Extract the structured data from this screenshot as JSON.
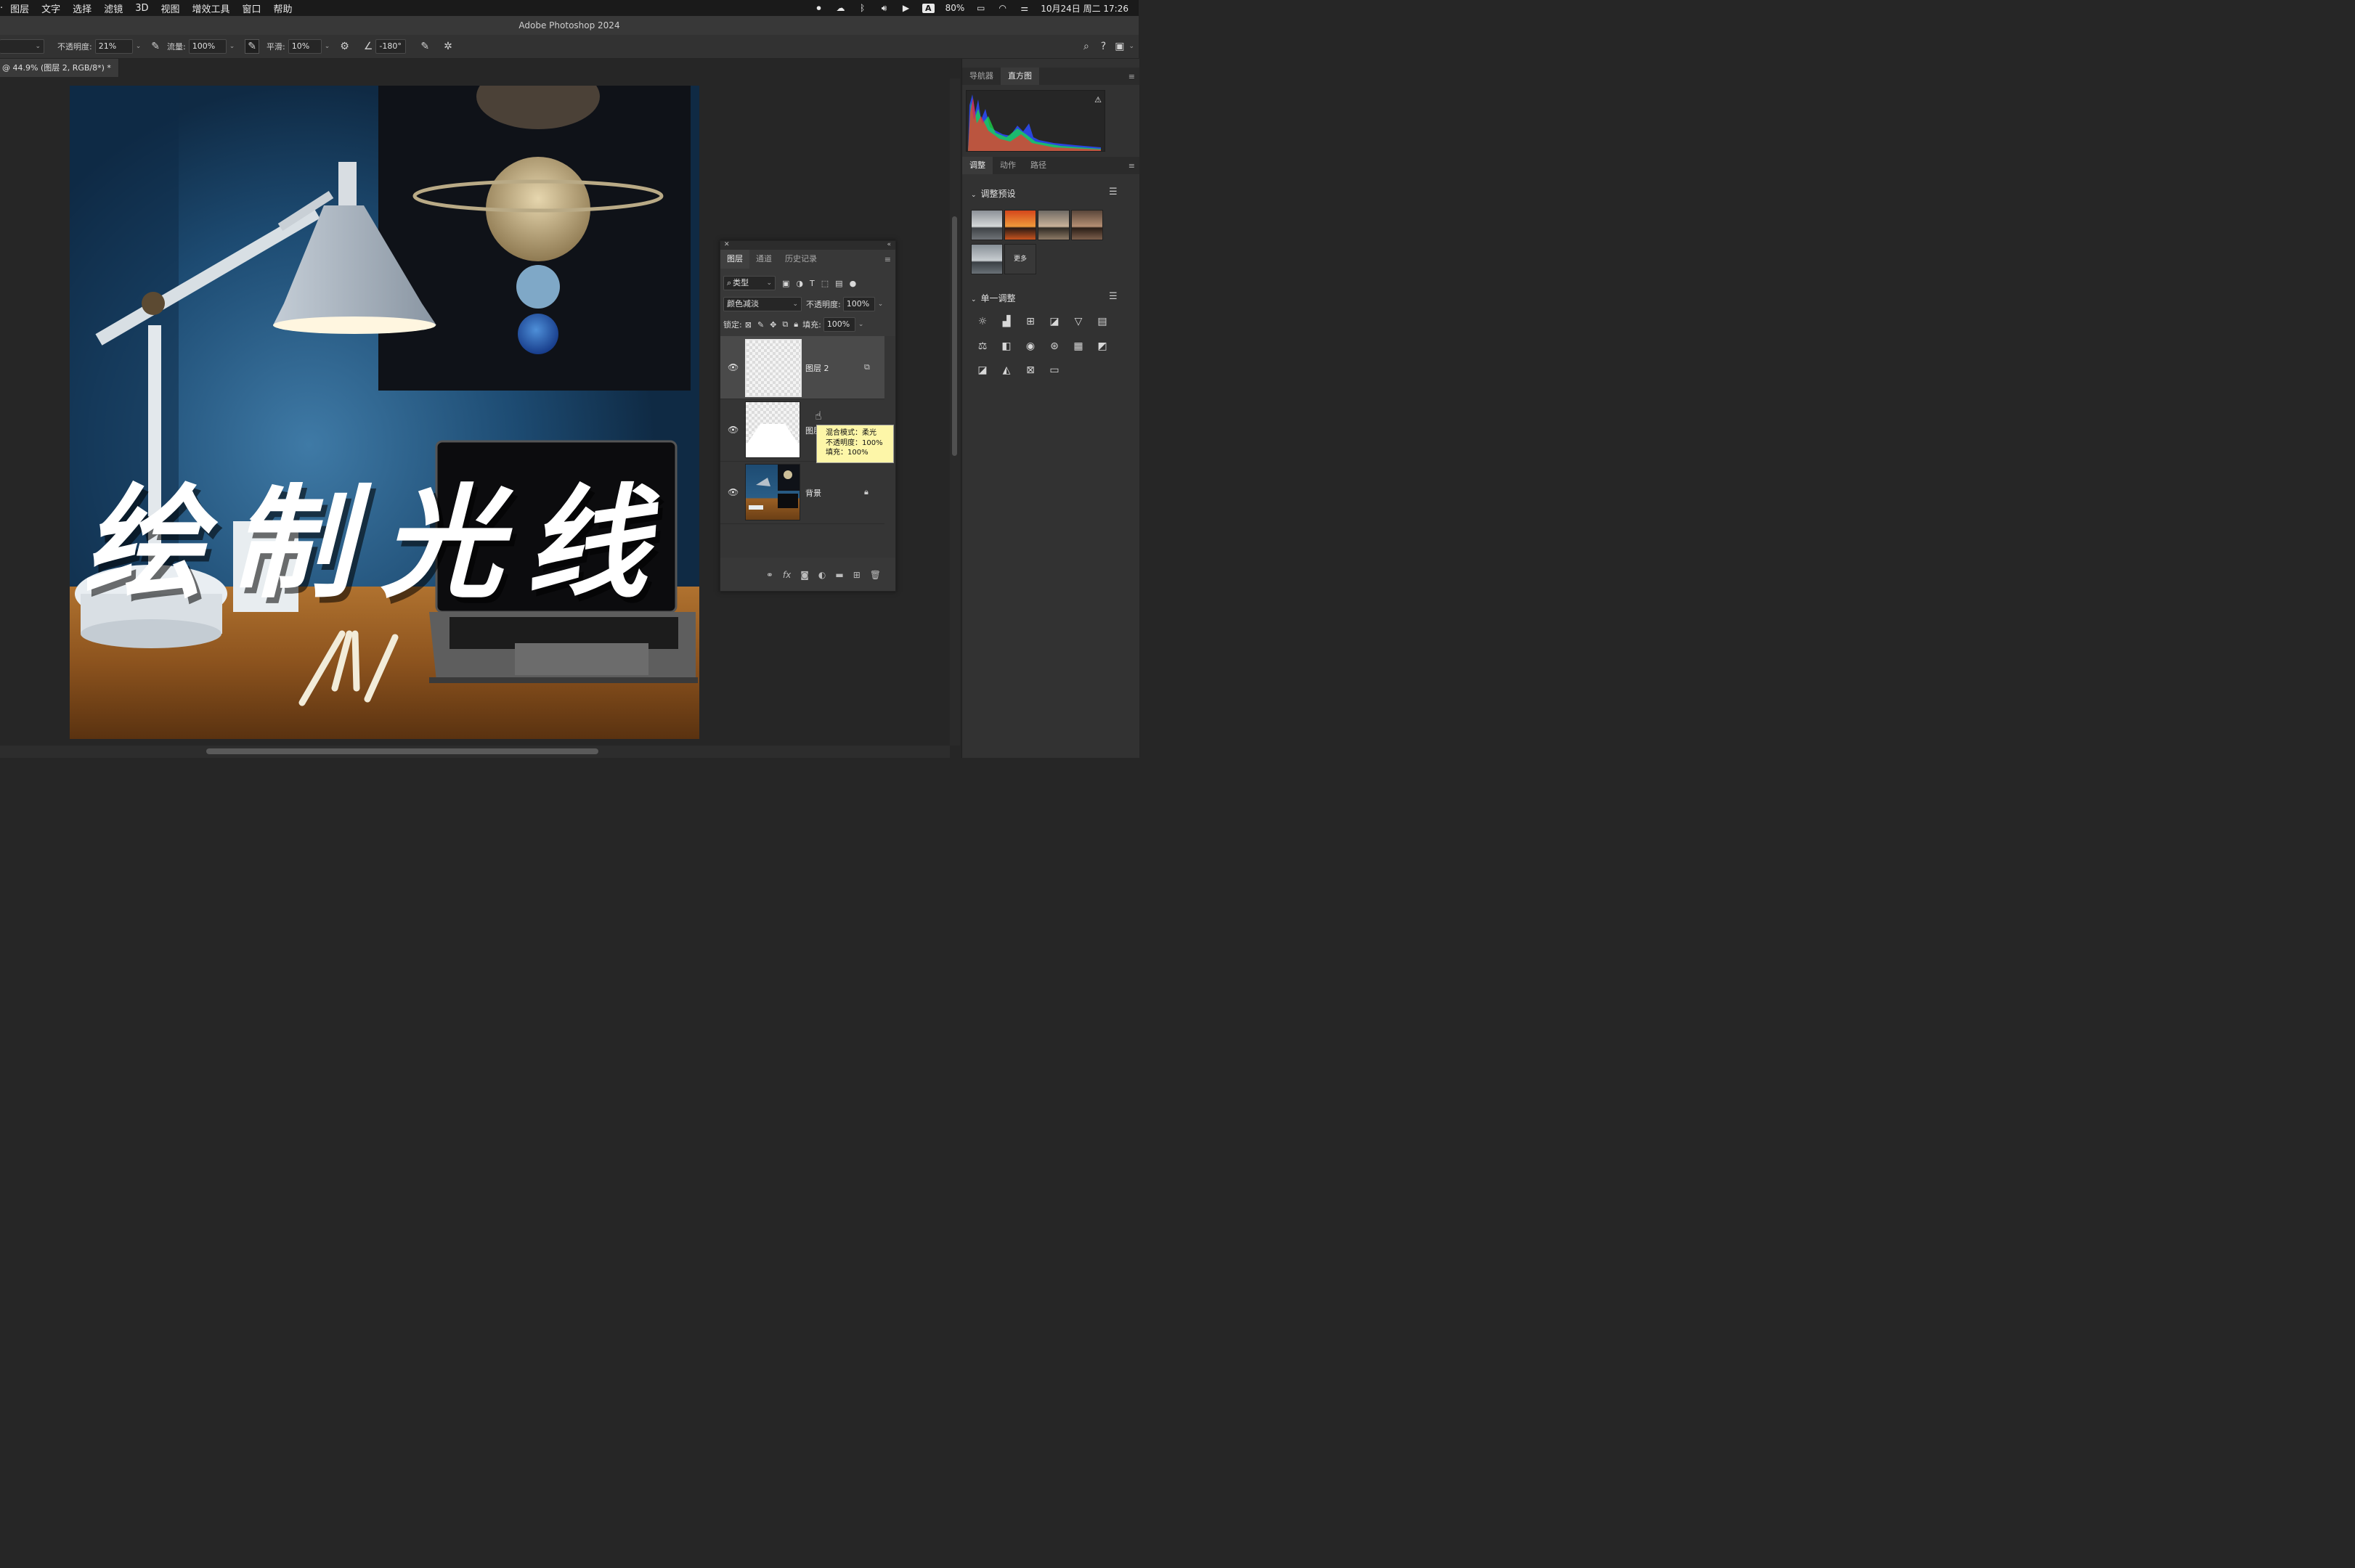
{
  "menubar": {
    "items": [
      "图层",
      "文字",
      "选择",
      "滤镜",
      "3D",
      "视图",
      "增效工具",
      "窗口",
      "帮助"
    ],
    "input_badge": "A",
    "battery": "80%",
    "datetime": "10月24日 周二 17:26"
  },
  "window": {
    "title": "Adobe Photoshop 2024"
  },
  "options": {
    "opacity_label": "不透明度:",
    "opacity_value": "21%",
    "flow_label": "流量:",
    "flow_value": "100%",
    "smooth_label": "平滑:",
    "smooth_value": "10%",
    "angle_value": "-180°"
  },
  "document": {
    "tab_label": "@ 44.9% (图层 2, RGB/8*) *"
  },
  "canvas": {
    "overlay_title": [
      "绘",
      "制",
      "光",
      "线"
    ]
  },
  "dock": {
    "top_tabs": [
      "导航器",
      "直方图"
    ],
    "mid_tabs": [
      "调整",
      "动作",
      "路径"
    ],
    "presets_header": "调整预设",
    "more_label": "更多",
    "single_header": "单一调整"
  },
  "layers_panel": {
    "tabs": [
      "图层",
      "通道",
      "历史记录"
    ],
    "filter_type": "类型",
    "blend_mode": "颜色减淡",
    "opacity_label": "不透明度:",
    "opacity_value": "100%",
    "lock_label": "锁定:",
    "fill_label": "填充:",
    "fill_value": "100%",
    "layers": [
      {
        "name": "图层 2",
        "selected": true
      },
      {
        "name": "图层",
        "selected": false
      },
      {
        "name": "背景",
        "selected": false
      }
    ],
    "tooltip": [
      "混合模式：柔光",
      "不透明度：100%",
      "填充：100%"
    ]
  }
}
